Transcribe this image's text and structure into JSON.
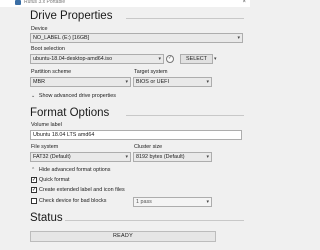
{
  "window": {
    "title": "Rufus 3.x Portable",
    "close_glyph": "×"
  },
  "drive_properties": {
    "heading": "Drive Properties",
    "device_label": "Device",
    "device_value": "NO_LABEL (E:) [16GB]",
    "boot_selection_label": "Boot selection",
    "boot_selection_value": "ubuntu-18.04-desktop-amd64.iso",
    "select_button": "SELECT",
    "partition_scheme_label": "Partition scheme",
    "partition_scheme_value": "MBR",
    "target_system_label": "Target system",
    "target_system_value": "BIOS or UEFI",
    "advanced_toggle": "Show advanced drive properties"
  },
  "format_options": {
    "heading": "Format Options",
    "volume_label_label": "Volume label",
    "volume_label_value": "Ubuntu 18.04 LTS amd64",
    "file_system_label": "File system",
    "file_system_value": "FAT32 (Default)",
    "cluster_size_label": "Cluster size",
    "cluster_size_value": "8192 bytes (Default)",
    "advanced_toggle": "Hide advanced format options",
    "quick_format": {
      "label": "Quick format",
      "checked": true
    },
    "extended_label": {
      "label": "Create extended label and icon files",
      "checked": true
    },
    "bad_blocks": {
      "label": "Check device for bad blocks",
      "checked": false
    },
    "passes_value": "1 pass"
  },
  "status": {
    "heading": "Status",
    "text": "READY"
  },
  "glyphs": {
    "dropdown": "▾",
    "chevron_down": "⌄",
    "chevron_up": "⌃",
    "check": "✓"
  }
}
